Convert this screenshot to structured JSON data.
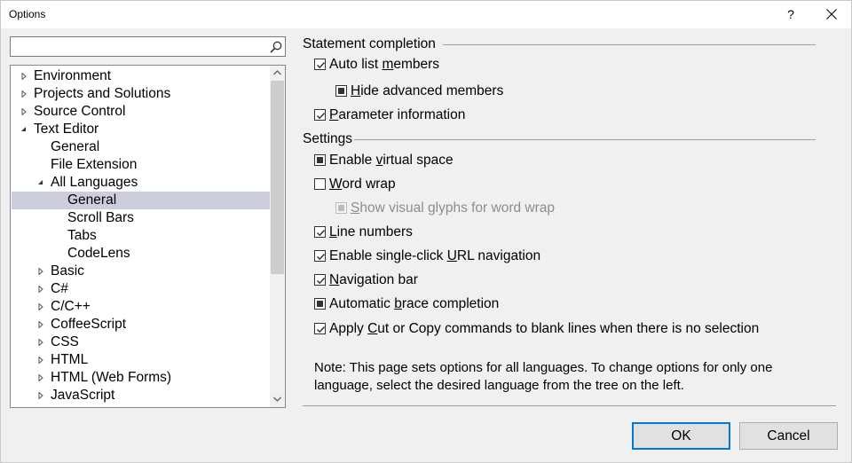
{
  "window": {
    "title": "Options",
    "help_label": "?",
    "close_icon": "close-icon"
  },
  "search": {
    "value": "",
    "placeholder": "",
    "icon": "search-icon"
  },
  "tree": {
    "items": [
      {
        "label": "Environment",
        "level": 0,
        "expander": "collapsed"
      },
      {
        "label": "Projects and Solutions",
        "level": 0,
        "expander": "collapsed"
      },
      {
        "label": "Source Control",
        "level": 0,
        "expander": "collapsed"
      },
      {
        "label": "Text Editor",
        "level": 0,
        "expander": "expanded"
      },
      {
        "label": "General",
        "level": 1,
        "expander": "none"
      },
      {
        "label": "File Extension",
        "level": 1,
        "expander": "none"
      },
      {
        "label": "All Languages",
        "level": 1,
        "expander": "expanded"
      },
      {
        "label": "General",
        "level": 2,
        "expander": "none",
        "selected": true
      },
      {
        "label": "Scroll Bars",
        "level": 2,
        "expander": "none"
      },
      {
        "label": "Tabs",
        "level": 2,
        "expander": "none"
      },
      {
        "label": "CodeLens",
        "level": 2,
        "expander": "none"
      },
      {
        "label": "Basic",
        "level": 1,
        "expander": "collapsed"
      },
      {
        "label": "C#",
        "level": 1,
        "expander": "collapsed"
      },
      {
        "label": "C/C++",
        "level": 1,
        "expander": "collapsed"
      },
      {
        "label": "CoffeeScript",
        "level": 1,
        "expander": "collapsed"
      },
      {
        "label": "CSS",
        "level": 1,
        "expander": "collapsed"
      },
      {
        "label": "HTML",
        "level": 1,
        "expander": "collapsed"
      },
      {
        "label": "HTML (Web Forms)",
        "level": 1,
        "expander": "collapsed"
      },
      {
        "label": "JavaScript",
        "level": 1,
        "expander": "collapsed"
      }
    ],
    "selected_color": "#cccedb"
  },
  "statement_completion": {
    "header": "Statement completion",
    "auto_list_members": {
      "pre": "Auto list ",
      "ul": "m",
      "post": "embers",
      "state": "checked"
    },
    "hide_advanced_members": {
      "pre": "",
      "ul": "H",
      "post": "ide advanced members",
      "state": "indeterminate"
    },
    "parameter_information": {
      "pre": "",
      "ul": "P",
      "post": "arameter information",
      "state": "checked"
    }
  },
  "settings": {
    "header": "Settings",
    "enable_virtual_space": {
      "pre": "Enable ",
      "ul": "v",
      "post": "irtual space",
      "state": "indeterminate"
    },
    "word_wrap": {
      "pre": "",
      "ul": "W",
      "post": "ord wrap",
      "state": "unchecked"
    },
    "show_visual_glyphs": {
      "pre": "",
      "ul": "S",
      "post": "how visual glyphs for word wrap",
      "state": "indeterminate-disabled"
    },
    "line_numbers": {
      "pre": "",
      "ul": "L",
      "post": "ine numbers",
      "state": "checked"
    },
    "single_click_url": {
      "pre": "Enable single-click ",
      "ul": "U",
      "post": "RL navigation",
      "state": "checked"
    },
    "navigation_bar": {
      "pre": "",
      "ul": "N",
      "post": "avigation bar",
      "state": "checked"
    },
    "automatic_brace": {
      "pre": "Automatic ",
      "ul": "b",
      "post": "race completion",
      "state": "indeterminate"
    },
    "apply_cut_copy": {
      "pre": "Apply ",
      "ul": "C",
      "post": "ut or Copy commands to blank lines when there is no selection",
      "state": "checked"
    }
  },
  "note": "Note: This page sets options for all languages. To change options for only one language, select the desired language from the tree on the left.",
  "buttons": {
    "ok": "OK",
    "cancel": "Cancel"
  },
  "colors": {
    "accent": "#0078d7",
    "window_bg": "#f0f0f0",
    "button_bg": "#e1e1e1"
  }
}
